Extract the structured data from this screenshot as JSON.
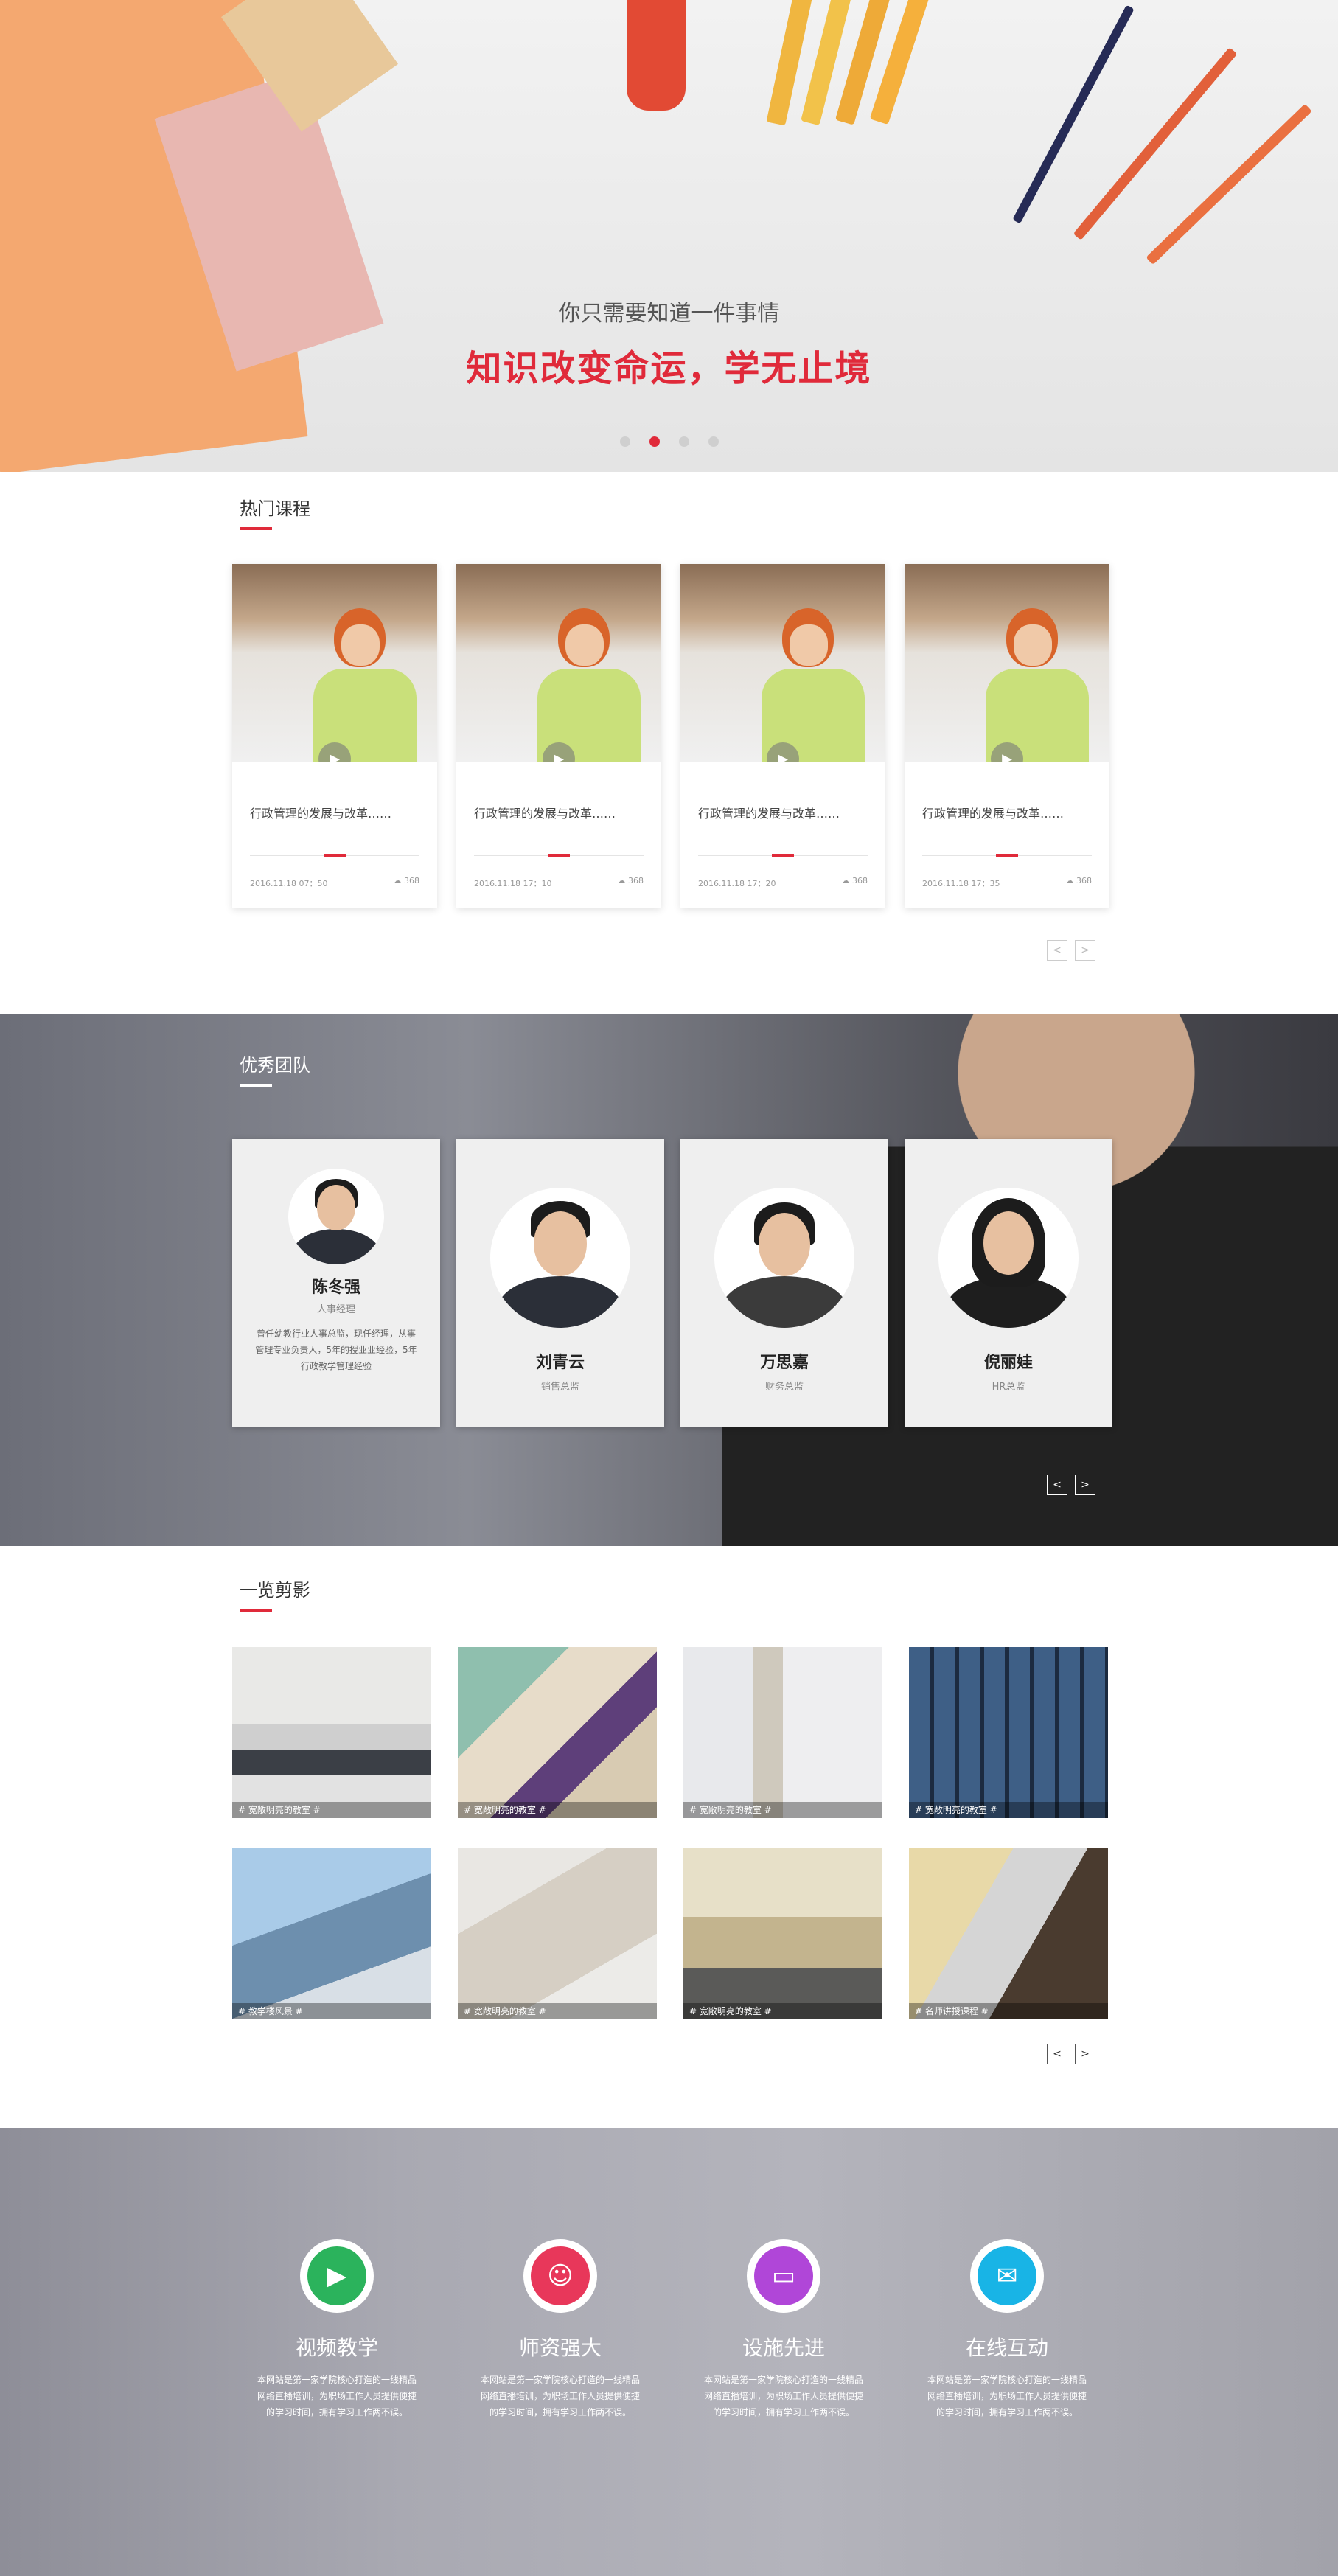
{
  "hero": {
    "subtitle": "你只需要知道一件事情",
    "title": "知识改变命运，学无止境",
    "slides": 4,
    "active_slide": 2
  },
  "courses": {
    "section_title": "热门课程",
    "items": [
      {
        "name": "行政管理的发展与改革……",
        "date": "2016.11.18 07：50",
        "views": "368"
      },
      {
        "name": "行政管理的发展与改革……",
        "date": "2016.11.18 17：10",
        "views": "368"
      },
      {
        "name": "行政管理的发展与改革……",
        "date": "2016.11.18 17：20",
        "views": "368"
      },
      {
        "name": "行政管理的发展与改革……",
        "date": "2016.11.18 17：35",
        "views": "368"
      }
    ],
    "prev": "<",
    "next": ">"
  },
  "team": {
    "section_title": "优秀团队",
    "members": [
      {
        "name": "陈冬强",
        "role": "人事经理",
        "desc": "曾任幼教行业人事总监，现任经理，从事管理专业负责人，5年的授业业经验，5年行政教学管理经验"
      },
      {
        "name": "刘青云",
        "role": "销售总监",
        "desc": ""
      },
      {
        "name": "万思嘉",
        "role": "财务总监",
        "desc": ""
      },
      {
        "name": "倪丽娃",
        "role": "HR总监",
        "desc": ""
      }
    ],
    "prev": "<",
    "next": ">"
  },
  "gallery": {
    "section_title": "一览剪影",
    "photos": [
      {
        "caption": "# 宽敞明亮的教室 #"
      },
      {
        "caption": "# 宽敞明亮的教室 #"
      },
      {
        "caption": "# 宽敞明亮的教室 #"
      },
      {
        "caption": "# 宽敞明亮的教室 #"
      },
      {
        "caption": "# 教学楼风景 #"
      },
      {
        "caption": "# 宽敞明亮的教室 #"
      },
      {
        "caption": "# 宽敞明亮的教室 #"
      },
      {
        "caption": "# 名师讲授课程 #"
      }
    ],
    "prev": "<",
    "next": ">"
  },
  "features": [
    {
      "title": "视频教学",
      "icon": "video-icon",
      "color": "#2bb35c",
      "desc": "本网站是第一家学院核心打造的一线精品网络直播培训，为职场工作人员提供便捷的学习时间，拥有学习工作两不误。"
    },
    {
      "title": "师资强大",
      "icon": "teacher-icon",
      "color": "#e8375a",
      "desc": "本网站是第一家学院核心打造的一线精品网络直播培训，为职场工作人员提供便捷的学习时间，拥有学习工作两不误。"
    },
    {
      "title": "设施先进",
      "icon": "monitor-icon",
      "color": "#b046d8",
      "desc": "本网站是第一家学院核心打造的一线精品网络直播培训，为职场工作人员提供便捷的学习时间，拥有学习工作两不误。"
    },
    {
      "title": "在线互动",
      "icon": "chat-icon",
      "color": "#18b4e6",
      "desc": "本网站是第一家学院核心打造的一线精品网络直播培训，为职场工作人员提供便捷的学习时间，拥有学习工作两不误。"
    }
  ]
}
